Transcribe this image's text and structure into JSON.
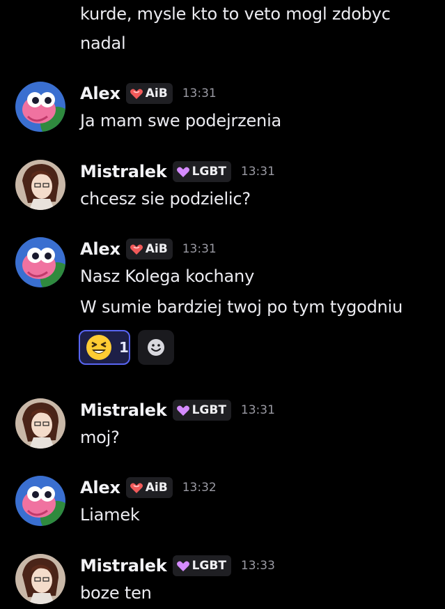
{
  "messages": {
    "m0": {
      "line1": "kurde, mysle kto to veto mogl zdobyc",
      "line2": "nadal"
    },
    "m1": {
      "author": "Alex",
      "tag": "AiB",
      "time": "13:31",
      "text": "Ja mam swe podejrzenia"
    },
    "m2": {
      "author": "Mistralek",
      "tag": "LGBT",
      "time": "13:31",
      "text": "chcesz sie podzielic?"
    },
    "m3": {
      "author": "Alex",
      "tag": "AiB",
      "time": "13:31",
      "text": "Nasz Kolega kochany",
      "text2": "W sumie bardziej twoj po tym tygodniu"
    },
    "m4": {
      "author": "Mistralek",
      "tag": "LGBT",
      "time": "13:31",
      "text": "moj?"
    },
    "m5": {
      "author": "Alex",
      "tag": "AiB",
      "time": "13:32",
      "text": "Liamek"
    },
    "m6": {
      "author": "Mistralek",
      "tag": "LGBT",
      "time": "13:33",
      "text": "boze ten"
    }
  },
  "reaction": {
    "emoji": "grinning-squinting-face",
    "count": "1"
  },
  "icons": {
    "alex_tag_icon": "heart-flame-icon",
    "mistralek_tag_icon": "purple-heart-icon",
    "add_reaction": "smiley-add-icon"
  },
  "colors": {
    "background": "#000000",
    "accent": "#5865f2",
    "alex_tag": "#f25a5a",
    "lgbt_tag": "#d58bff",
    "timestamp": "#9a9aa3"
  }
}
